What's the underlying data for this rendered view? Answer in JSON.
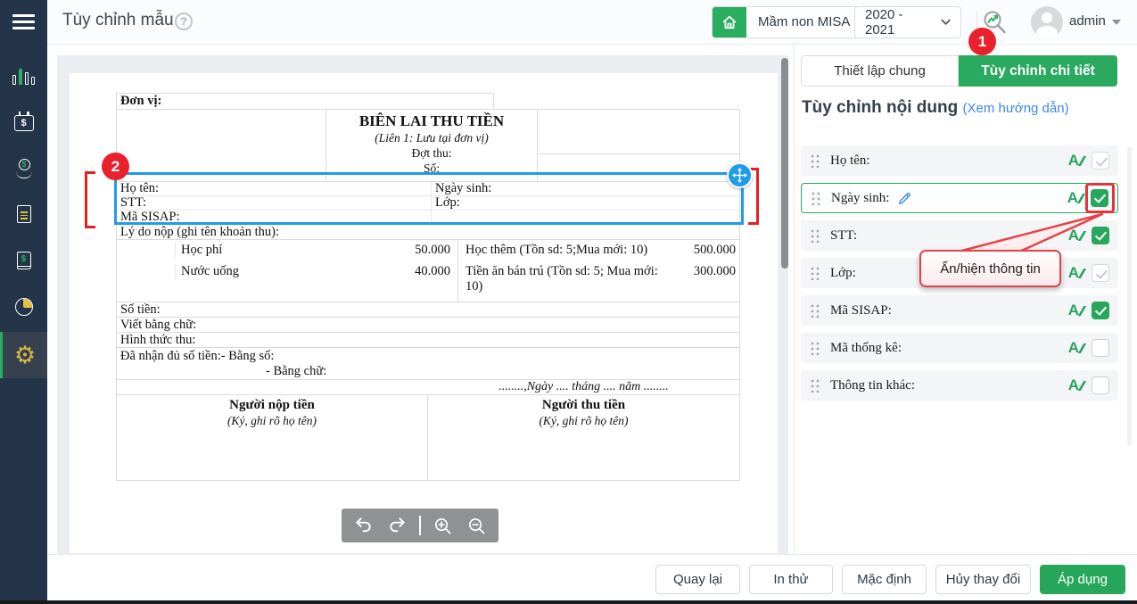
{
  "colors": {
    "green": "#2bad60",
    "red": "#e8212d",
    "selection_blue": "#1e9ce8",
    "link_blue": "#3d87e6",
    "sidebar_bg": "#243449",
    "canvas_bg": "#eaedf2"
  },
  "topbar": {
    "title": "Tùy chỉnh mẫu",
    "help_icon": "?",
    "school_button": "Mầm non MISA",
    "school_year": "2020 - 2021",
    "username": "admin"
  },
  "sidebar": {
    "items": [
      {
        "icon": "bar-chart"
      },
      {
        "icon": "calendar-dollar",
        "glyph": "$"
      },
      {
        "icon": "hand-coin",
        "glyph": "$"
      },
      {
        "icon": "document"
      },
      {
        "icon": "cash-book",
        "glyph": "$"
      },
      {
        "icon": "pie-chart"
      },
      {
        "icon": "gear",
        "glyph": "⚙",
        "active": true
      }
    ]
  },
  "annotations": {
    "step1": "1",
    "step2": "2",
    "tooltip": "Ẩn/hiện thông tin"
  },
  "document": {
    "unit_label": "Đơn vị:",
    "title": "BIÊN LAI THU TIỀN",
    "copy_note": "(Liên 1: Lưu tại đơn vị)",
    "batch_label": "Đợt thu:",
    "number_label": "Số:",
    "fields": {
      "name": "Họ tên:",
      "dob": "Ngày sinh:",
      "stt": "STT:",
      "class": "Lớp:",
      "sisap": "Mã SISAP:"
    },
    "reason_label": "Lý do nộp (ghi tên khoản thu):",
    "fee_rows": [
      {
        "left_name": "Học phí",
        "left_amount": "50.000",
        "right_name": "Học thêm (Tồn sd: 5;Mua mới: 10)",
        "right_amount": "500.000"
      },
      {
        "left_name": "Nước uống",
        "left_amount": "40.000",
        "right_name": "Tiền ăn bán trú (Tồn sd: 5; Mua mới: 10)",
        "right_amount": "300.000"
      }
    ],
    "amount_label": "Số tiền:",
    "in_words_label": "Viết bằng chữ:",
    "method_label": "Hình thức thu:",
    "received_line1": "Đã nhận đủ số tiền:- Bằng số:",
    "received_line2": "- Bằng chữ:",
    "date_line": "........,Ngày .... tháng .... năm ........",
    "payer": {
      "title": "Người nộp tiền",
      "note": "(Ký, ghi rõ họ tên)"
    },
    "collector": {
      "title": "Người thu tiền",
      "note": "(Ký, ghi rõ họ tên)"
    }
  },
  "panel": {
    "tabs": [
      {
        "label": "Thiết lập chung",
        "active": false
      },
      {
        "label": "Tùy chỉnh chi tiết",
        "active": true
      }
    ],
    "heading": "Tùy chỉnh nội dung",
    "guide_link": "(Xem hướng dẫn)",
    "items": [
      {
        "label": "Họ tên:",
        "checkbox": "checked-disabled"
      },
      {
        "label": "Ngày sinh:",
        "checkbox": "checked",
        "selected": true,
        "editable": true
      },
      {
        "label": "STT:",
        "checkbox": "checked"
      },
      {
        "label": "Lớp:",
        "checkbox": "checked-disabled"
      },
      {
        "label": "Mã SISAP:",
        "checkbox": "checked"
      },
      {
        "label": "Mã thống kê:",
        "checkbox": "unchecked"
      },
      {
        "label": "Thông tin khác:",
        "checkbox": "unchecked"
      }
    ]
  },
  "footer": {
    "buttons": [
      "Quay lại",
      "In thử",
      "Mặc định",
      "Hủy thay đổi",
      "Áp dụng"
    ]
  }
}
